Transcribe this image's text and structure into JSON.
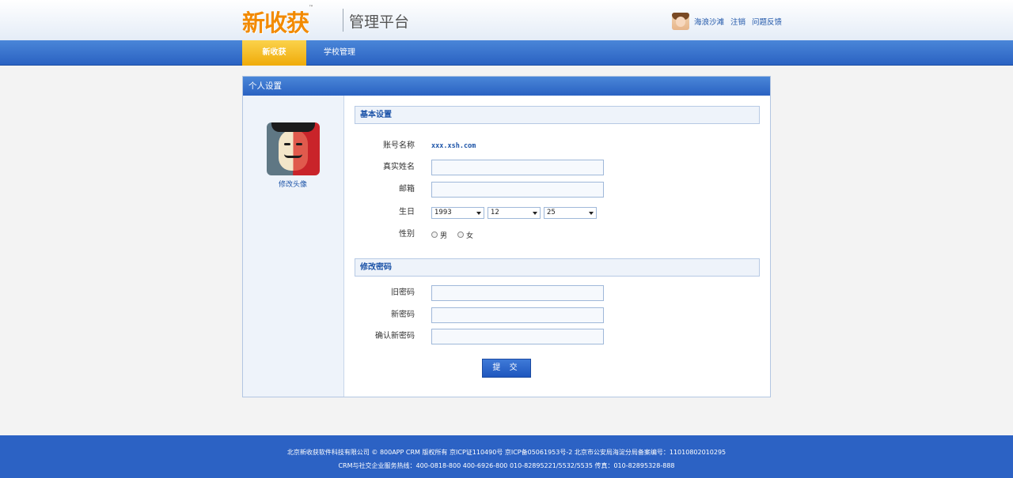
{
  "header": {
    "logo_text": "新收获",
    "logo_tm": "™",
    "platform_title": "管理平台",
    "user_name": "海浪沙滩",
    "logout_label": "注销",
    "feedback_label": "问题反馈"
  },
  "nav": {
    "items": [
      {
        "label": "新收获"
      },
      {
        "label": "学校管理"
      }
    ],
    "active_color": "#f4be2b",
    "bar_color": "#2f6bc9"
  },
  "panel": {
    "title": "个人设置",
    "change_avatar_label": "修改头像",
    "basic_section_title": "基本设置",
    "account_label": "账号名称",
    "account_value": "xxx.xsh.com",
    "realname_label": "真实姓名",
    "realname_value": "",
    "email_label": "邮箱",
    "email_value": "",
    "birthday_label": "生日",
    "birthday_year": "1993",
    "birthday_month": "12",
    "birthday_day": "25",
    "gender_label": "性别",
    "gender_male": "男",
    "gender_female": "女",
    "password_section_title": "修改密码",
    "old_password_label": "旧密码",
    "new_password_label": "新密码",
    "confirm_password_label": "确认新密码",
    "submit_label": "提 交"
  },
  "footer": {
    "line1": "北京新收获软件科技有限公司 © 800APP CRM 版权所有 京ICP证110490号 京ICP备05061953号-2 北京市公安局海淀分局备案编号：1101080201​0295",
    "line2": "CRM与社交企业服务热线：400-0818-800 400-6926-800 010-82895221/5532/5535 传真：010-82895328-888"
  }
}
